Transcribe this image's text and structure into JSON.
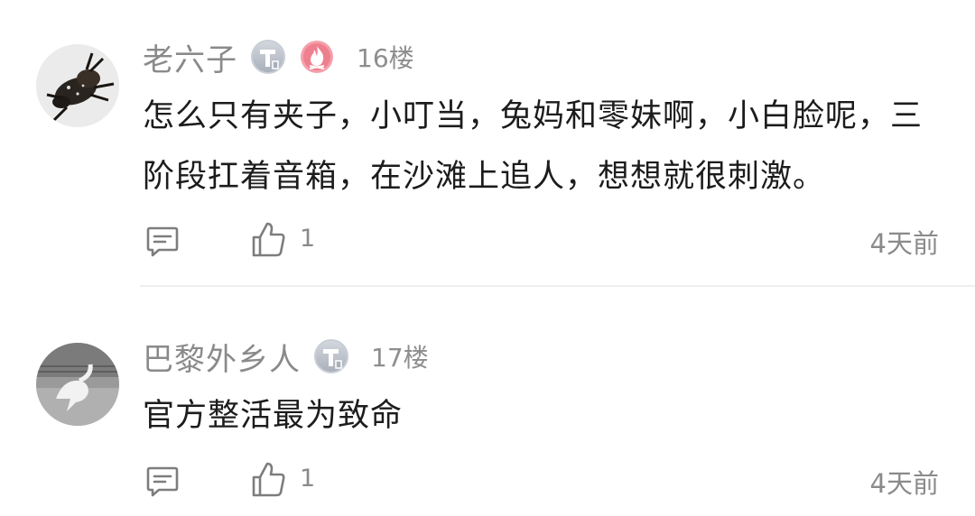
{
  "comments": [
    {
      "username": "老六子",
      "floor": "16楼",
      "text": "怎么只有夹子，小叮当，兔妈和零妹啊，小白脸呢，三阶段扛着音箱，在沙滩上追人，想想就很刺激。",
      "likes": "1",
      "time": "4天前",
      "badges": [
        "t-level-badge",
        "fire-badge"
      ]
    },
    {
      "username": "巴黎外乡人",
      "floor": "17楼",
      "text": "官方整活最为致命",
      "likes": "1",
      "time": "4天前",
      "badges": [
        "t-level-badge"
      ]
    }
  ],
  "icons": {
    "reply": "comment-reply-icon",
    "like": "thumbs-up-icon"
  },
  "colors": {
    "text": "#1c1c1c",
    "muted": "#8a8a8a",
    "badge_gray": "#b7bcc6",
    "badge_fire": "#f07b8a"
  }
}
